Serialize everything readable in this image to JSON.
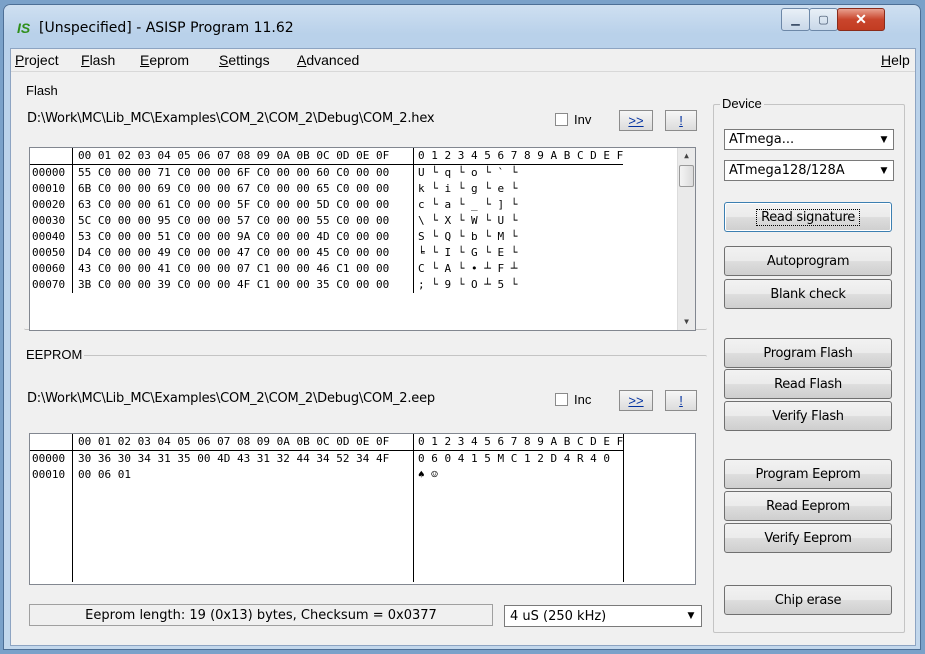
{
  "window": {
    "title": "[Unspecified] - ASISP Program 11.62",
    "logo": "IS"
  },
  "menu": {
    "items": [
      {
        "u": "P",
        "rest": "roject"
      },
      {
        "u": "F",
        "rest": "lash"
      },
      {
        "u": "E",
        "rest": "eprom"
      },
      {
        "u": "S",
        "rest": "ettings"
      },
      {
        "u": "A",
        "rest": "dvanced"
      }
    ],
    "help": {
      "u": "H",
      "rest": "elp"
    }
  },
  "flash": {
    "label": "Flash",
    "path": "D:\\Work\\MC\\Lib_MC\\Examples\\COM_2\\COM_2\\Debug\\COM_2.hex",
    "inv_label": "Inv",
    "more_label": ">>",
    "excl_label": "!",
    "header_hex": "00 01 02 03 04 05 06 07 08 09 0A 0B 0C 0D 0E 0F",
    "header_asc": "0 1 2 3 4 5 6 7 8 9 A B C D E F",
    "rows": [
      {
        "addr": "00000",
        "hex": "55 C0 00 00 71 C0 00 00 6F C0 00 00 60 C0 00 00",
        "asc": "U └    q └    o └    ` └"
      },
      {
        "addr": "00010",
        "hex": "6B C0 00 00 69 C0 00 00 67 C0 00 00 65 C0 00 00",
        "asc": "k └    i └    g └    e └"
      },
      {
        "addr": "00020",
        "hex": "63 C0 00 00 61 C0 00 00 5F C0 00 00 5D C0 00 00",
        "asc": "c └    a └    _ └    ] └"
      },
      {
        "addr": "00030",
        "hex": "5C C0 00 00 95 C0 00 00 57 C0 00 00 55 C0 00 00",
        "asc": "\\ └    X └    W └    U └"
      },
      {
        "addr": "00040",
        "hex": "53 C0 00 00 51 C0 00 00 9A C0 00 00 4D C0 00 00",
        "asc": "S └    Q └    b └    M └"
      },
      {
        "addr": "00050",
        "hex": "D4 C0 00 00 49 C0 00 00 47 C0 00 00 45 C0 00 00",
        "asc": "╘ └    I └    G └    E └"
      },
      {
        "addr": "00060",
        "hex": "43 C0 00 00 41 C0 00 00 07 C1 00 00 46 C1 00 00",
        "asc": "C └    A └    • ┴    F ┴"
      },
      {
        "addr": "00070",
        "hex": "3B C0 00 00 39 C0 00 00 4F C1 00 00 35 C0 00 00",
        "asc": "; └    9 └    O ┴    5 └"
      }
    ]
  },
  "eeprom": {
    "label": "EEPROM",
    "path": "D:\\Work\\MC\\Lib_MC\\Examples\\COM_2\\COM_2\\Debug\\COM_2.eep",
    "inc_label": "Inc",
    "more_label": ">>",
    "excl_label": "!",
    "header_hex": "00 01 02 03 04 05 06 07 08 09 0A 0B 0C 0D 0E 0F",
    "header_asc": "0 1 2 3 4 5 6 7 8 9 A B C D E F",
    "rows": [
      {
        "addr": "00000",
        "hex": "30 36 30 34 31 35 00 4D 43 31 32 44 34 52 34 4F",
        "asc": "0 6 0 4 1 5   M C 1 2 D 4 R 4 0"
      },
      {
        "addr": "00010",
        "hex": "00 06 01",
        "asc": "  ♠ ☺"
      }
    ]
  },
  "device": {
    "label": "Device",
    "family": "ATmega...",
    "model": "ATmega128/128A"
  },
  "buttons": {
    "read_signature": "Read signature",
    "autoprogram": "Autoprogram",
    "blank_check": "Blank check",
    "program_flash": "Program Flash",
    "read_flash": "Read Flash",
    "verify_flash": "Verify Flash",
    "program_eeprom": "Program Eeprom",
    "read_eeprom": "Read Eeprom",
    "verify_eeprom": "Verify Eeprom",
    "chip_erase": "Chip erase"
  },
  "status": {
    "text": "Eeprom length: 19 (0x13) bytes, Checksum = 0x0377",
    "speed": "4 uS (250 kHz)"
  }
}
